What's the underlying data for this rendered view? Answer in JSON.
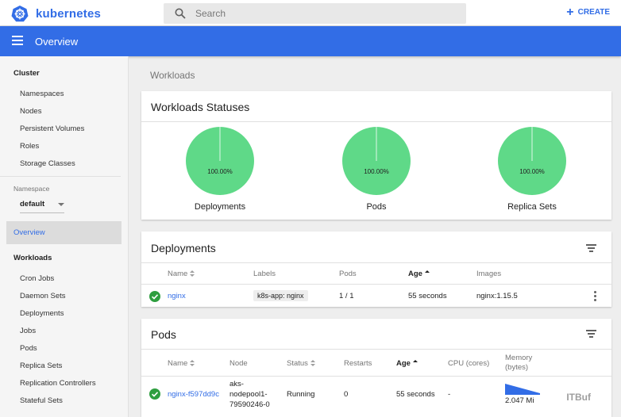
{
  "app": {
    "brand": "kubernetes",
    "create_label": "CREATE",
    "page_title": "Overview"
  },
  "search": {
    "placeholder": "Search"
  },
  "sidebar": {
    "cluster_heading": "Cluster",
    "cluster_items": [
      "Namespaces",
      "Nodes",
      "Persistent Volumes",
      "Roles",
      "Storage Classes"
    ],
    "namespace_label": "Namespace",
    "namespace_value": "default",
    "active_item": "Overview",
    "workloads_heading": "Workloads",
    "workload_items": [
      "Cron Jobs",
      "Daemon Sets",
      "Deployments",
      "Jobs",
      "Pods",
      "Replica Sets",
      "Replication Controllers",
      "Stateful Sets"
    ]
  },
  "breadcrumb": "Workloads",
  "statuses": {
    "title": "Workloads Statuses",
    "charts": [
      {
        "label": "Deployments",
        "percent": "100.00%",
        "value": 100
      },
      {
        "label": "Pods",
        "percent": "100.00%",
        "value": 100
      },
      {
        "label": "Replica Sets",
        "percent": "100.00%",
        "value": 100
      }
    ]
  },
  "deployments": {
    "title": "Deployments",
    "headers": {
      "name": "Name",
      "labels": "Labels",
      "pods": "Pods",
      "age": "Age",
      "images": "Images"
    },
    "rows": [
      {
        "name": "nginx",
        "label": "k8s-app: nginx",
        "pods": "1 / 1",
        "age": "55 seconds",
        "images": "nginx:1.15.5"
      }
    ]
  },
  "pods": {
    "title": "Pods",
    "headers": {
      "name": "Name",
      "node": "Node",
      "status": "Status",
      "restarts": "Restarts",
      "age": "Age",
      "cpu": "CPU (cores)",
      "memory": "Memory (bytes)"
    },
    "rows": [
      {
        "name": "nginx-f597dd9c",
        "node_lines": [
          "aks-",
          "nodepool1-",
          "79590246-0"
        ],
        "status": "Running",
        "restarts": "0",
        "age": "55 seconds",
        "cpu": "-",
        "memory": "2.047 Mi"
      }
    ]
  },
  "colors": {
    "accent": "#326de6",
    "pie_fill": "#5fd988",
    "ok": "#2e9e3f"
  },
  "watermark": "ITBuf"
}
